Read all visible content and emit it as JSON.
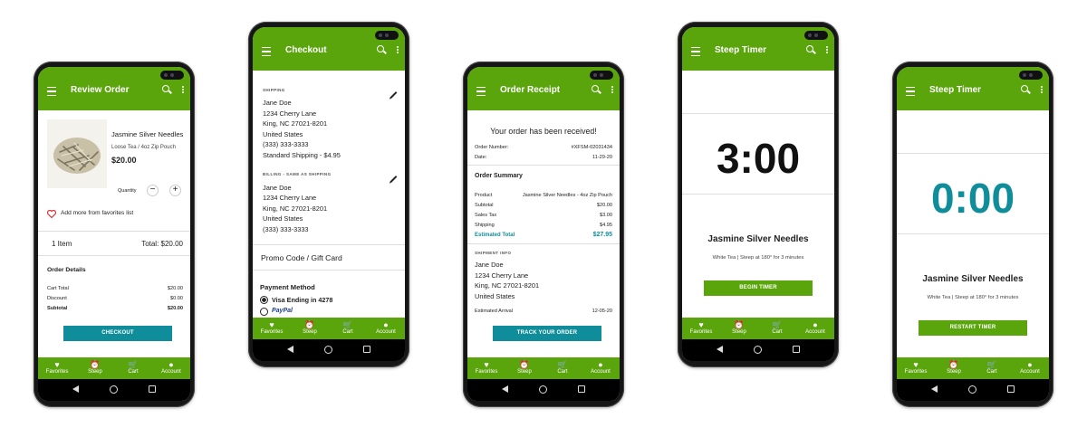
{
  "colors": {
    "appbar": "#5aa40c",
    "accent": "#0f8d9a",
    "timer_teal": "#0f8d9a"
  },
  "nav": {
    "items": [
      {
        "label": "Favorites",
        "icon": "heart-icon"
      },
      {
        "label": "Steep",
        "icon": "alarm-icon"
      },
      {
        "label": "Cart",
        "icon": "cart-icon"
      },
      {
        "label": "Account",
        "icon": "account-icon"
      }
    ]
  },
  "review": {
    "title": "Review Order",
    "product_name": "Jasmine Silver Needles",
    "product_desc": "Loose Tea / 4oz Zip Pouch",
    "price": "$20.00",
    "quantity_label": "Quantity",
    "favorites_link": "Add more from favorites list",
    "item_count": "1 Item",
    "total": "Total: $20.00",
    "details_title": "Order Details",
    "rows": [
      {
        "label": "Cart Total",
        "value": "$20.00"
      },
      {
        "label": "Discount",
        "value": "$0.00"
      },
      {
        "label": "Subtotal",
        "value": "$20.00"
      }
    ],
    "checkout_button": "CHECKOUT"
  },
  "checkout": {
    "title": "Checkout",
    "shipping_label": "SHIPPING",
    "shipping_lines": [
      "Jane Doe",
      "1234 Cherry Lane",
      "King, NC 27021-8201",
      "United States",
      "(333) 333-3333",
      "Standard Shipping - $4.95"
    ],
    "billing_label": "BILLING - SAME AS SHIPPING",
    "billing_lines": [
      "Jane Doe",
      "1234 Cherry Lane",
      "King, NC 27021-8201",
      "United States",
      "(333) 333-3333"
    ],
    "promo": "Promo Code / Gift Card",
    "payment_title": "Payment Method",
    "payment_option": "Visa Ending in 4278",
    "paypal": "PayPal"
  },
  "receipt": {
    "title": "Order Receipt",
    "heading": "Your order has been received!",
    "order_number_label": "Order Number:",
    "order_number": "#XFSM-02031434",
    "date_label": "Date:",
    "date": "11-29-20",
    "summary_title": "Order Summary",
    "rows": [
      {
        "label": "Product",
        "value": "Jasmine Silver Needles - 4oz Zip Pouch"
      },
      {
        "label": "Subtotal",
        "value": "$20.00"
      },
      {
        "label": "Sales Tax",
        "value": "$3.00"
      },
      {
        "label": "Shipping",
        "value": "$4.95"
      }
    ],
    "estimated_label": "Estimated Total",
    "estimated_value": "$27.95",
    "shipment_label": "SHIPMENT INFO",
    "shipment_lines": [
      "Jane Doe",
      "1234 Cherry Lane",
      "King, NC 27021-8201",
      "United States"
    ],
    "arrival_label": "Estimated Arrival",
    "arrival": "12-05-20",
    "track_button": "TRACK YOUR ORDER"
  },
  "timer1": {
    "title": "Steep Timer",
    "time": "3:00",
    "tea": "Jasmine Silver Needles",
    "desc": "White Tea | Steep at 180° for 3 minutes",
    "button": "BEGIN TIMER"
  },
  "timer2": {
    "title": "Steep Timer",
    "time": "0:00",
    "tea": "Jasmine Silver Needles",
    "desc": "White Tea | Steep at 180° for 3 minutes",
    "button": "RESTART TIMER"
  }
}
